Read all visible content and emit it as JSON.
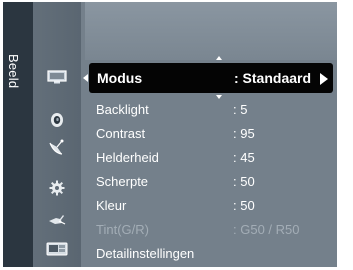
{
  "menu": {
    "title": "Beeld",
    "nav_icons": [
      "screen-icon",
      "sound-icon",
      "satellite-dish-icon",
      "gear-icon",
      "input-plug-icon",
      "application-icon"
    ],
    "selected": {
      "label": "Modus",
      "value": ": Standaard"
    },
    "items": [
      {
        "label": "Backlight",
        "value": ": 5"
      },
      {
        "label": "Contrast",
        "value": ": 95"
      },
      {
        "label": "Helderheid",
        "value": ": 45"
      },
      {
        "label": "Scherpte",
        "value": ": 50"
      },
      {
        "label": "Kleur",
        "value": ": 50"
      },
      {
        "label": "Tint(G/R)",
        "value": ": G50 / R50",
        "disabled": true
      },
      {
        "label": "Detailinstellingen",
        "value": ""
      }
    ]
  }
}
